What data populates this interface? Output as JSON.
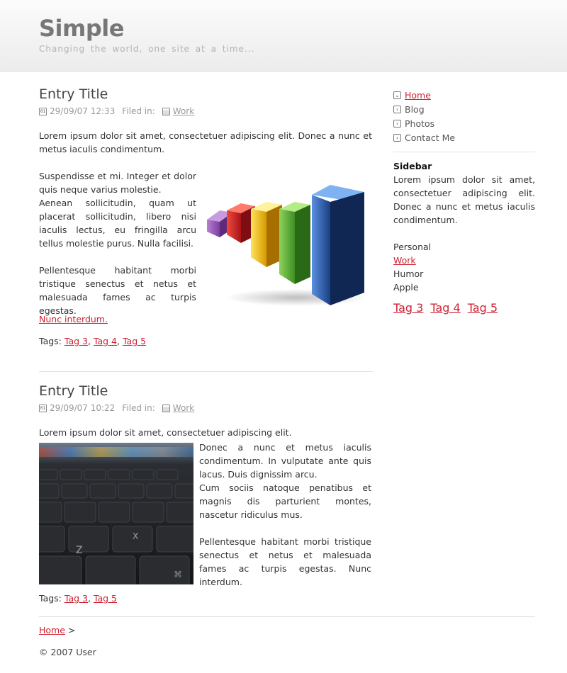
{
  "site": {
    "title": "Simple",
    "tagline": "Changing the world, one site at a time..."
  },
  "posts": [
    {
      "title": "Entry Title",
      "date": "29/09/07 12:33",
      "filed_label": "Filed in:",
      "category": "Work",
      "intro": "Lorem ipsum dolor sit amet, consectetuer adipiscing elit. Donec a nunc et metus iaculis condimentum.",
      "para1_l1": "Suspendisse et mi. Integer et dolor quis neque varius molestie.",
      "para1_l2": "Aenean sollicitudin, quam ut placerat sollicitudin, libero nisi iaculis lectus, eu fringilla arcu tellus molestie purus. Nulla facilisi.",
      "para2": "Pellentesque habitant morbi tristique senectus et netus et malesuada fames ac turpis egestas.",
      "more_link": "Nunc interdum.",
      "tags_label": "Tags:",
      "tags": [
        "Tag 3",
        "Tag 4",
        "Tag 5"
      ]
    },
    {
      "title": "Entry Title",
      "date": "29/09/07 10:22",
      "filed_label": "Filed in:",
      "category": "Work",
      "intro": "Lorem ipsum dolor sit amet, consectetuer adipiscing elit.",
      "para1_l1": "Donec a nunc et metus iaculis condimentum. In vulputate ante quis lacus. Duis dignissim arcu.",
      "para1_l2": "Cum sociis natoque penatibus et magnis dis parturient montes, nascetur ridiculus mus.",
      "para2": "Pellentesque habitant morbi tristique senectus et netus et malesuada fames ac turpis egestas. Nunc interdum.",
      "tags_label": "Tags:",
      "tags": [
        "Tag 3",
        "Tag 5"
      ]
    }
  ],
  "sidebar": {
    "nav": [
      {
        "label": "Home",
        "active": true
      },
      {
        "label": "Blog"
      },
      {
        "label": "Photos"
      },
      {
        "label": "Contact Me"
      }
    ],
    "heading": "Sidebar",
    "text": "Lorem ipsum dolor sit amet, consectetuer adipiscing elit. Donec a nunc et metus iaculis condimentum.",
    "categories": [
      "Personal",
      "Work",
      "Humor",
      "Apple"
    ],
    "tag_cloud": [
      "Tag 3",
      "Tag 4",
      "Tag 5"
    ]
  },
  "footer": {
    "crumb": "Home",
    "crumb_sep": ">",
    "copyright": "© 2007 User"
  },
  "colors": {
    "link": "#cc2233",
    "bar_colors": [
      "#9b59b6",
      "#e02a2a",
      "#f2c21b",
      "#63b83a",
      "#2f62b0"
    ]
  }
}
